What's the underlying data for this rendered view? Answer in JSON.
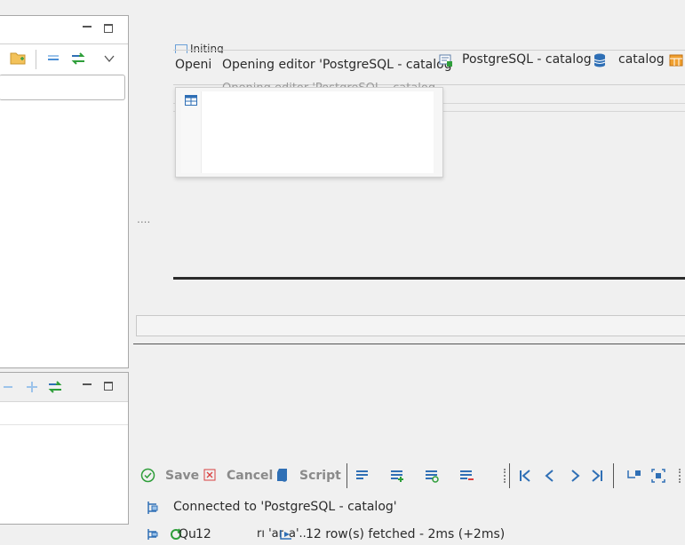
{
  "tabs": {
    "opening_text_a": "Openi",
    "opening_text_b": "Opening editor 'PostgreSQL - catalog",
    "ghost_text": "Opening editor 'PostgreSQL - catalog",
    "initing_label": "Initing",
    "connection_label": "PostgreSQL - catalog",
    "database_label": "catalog"
  },
  "editor": {
    "ellipsis": "...."
  },
  "results_toolbar": {
    "save_label": "Save",
    "cancel_label": "Cancel",
    "script_label": "Script"
  },
  "status": {
    "connected_text": "Connected to 'PostgreSQL - catalog'",
    "query_prefix": "Qu",
    "row_count": "12",
    "overlap_fragment": "rı 'ar",
    "overlap_fragment2": "a'.. ",
    "fetched_text": "12 row(s) fetched - 2ms (+2ms)"
  },
  "colors": {
    "accent_blue": "#2f6fb5",
    "accent_green": "#2e9e3a",
    "cancel_red": "#d94040",
    "folder_orange": "#f0a030"
  }
}
